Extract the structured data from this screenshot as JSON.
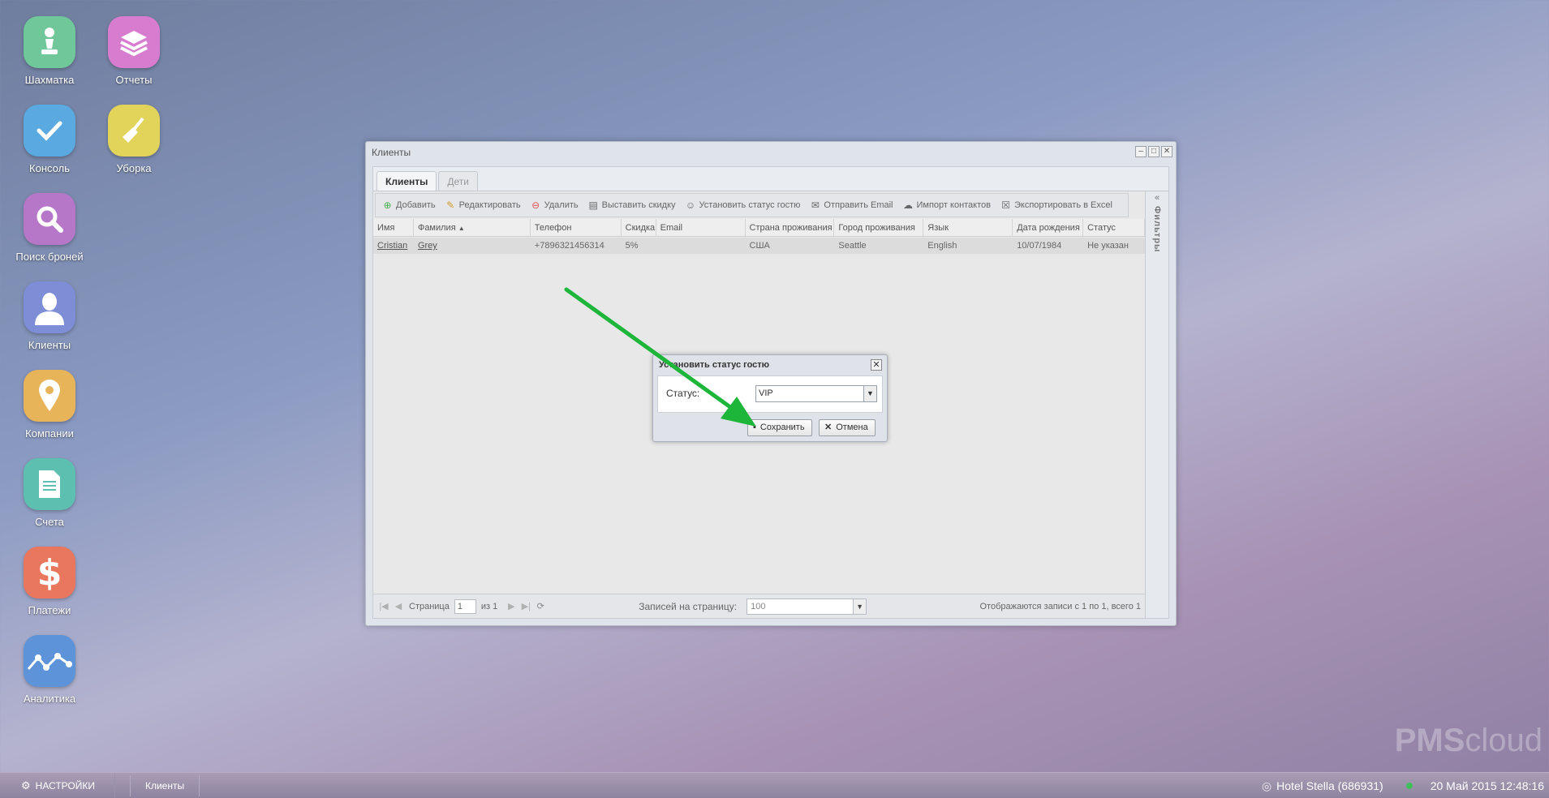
{
  "desktop": {
    "icons": [
      {
        "label": "Шахматка",
        "icon": "chess-pawn-icon",
        "color": "#6fc79a"
      },
      {
        "label": "Отчеты",
        "icon": "books-icon",
        "color": "#d77ccf"
      },
      {
        "label": "Консоль",
        "icon": "checkmark-icon",
        "color": "#5aa9e0"
      },
      {
        "label": "Уборка",
        "icon": "broom-icon",
        "color": "#e2d35a"
      },
      {
        "label": "Поиск броней",
        "icon": "search-icon",
        "color": "#b677c9"
      },
      {
        "label": "Клиенты",
        "icon": "person-icon",
        "color": "#7d8ed6"
      },
      {
        "label": "Компании",
        "icon": "map-pin-icon",
        "color": "#e8b45a"
      },
      {
        "label": "Счета",
        "icon": "document-icon",
        "color": "#5cbfb0"
      },
      {
        "label": "Платежи",
        "icon": "dollar-icon",
        "color": "#e8775e"
      },
      {
        "label": "Аналитика",
        "icon": "line-chart-icon",
        "color": "#5d93d8"
      }
    ]
  },
  "window": {
    "title": "Клиенты",
    "tabs": [
      {
        "label": "Клиенты",
        "active": true
      },
      {
        "label": "Дети",
        "active": false
      }
    ],
    "toolbar": {
      "add": "Добавить",
      "edit": "Редактировать",
      "delete": "Удалить",
      "discount": "Выставить скидку",
      "set_status": "Установить статус гостю",
      "send_email": "Отправить Email",
      "import": "Импорт контактов",
      "export": "Экспортировать в Excel"
    },
    "columns": [
      "Имя",
      "Фамилия",
      "Телефон",
      "Скидка",
      "Email",
      "Страна проживания",
      "Город проживания",
      "Язык",
      "Дата рождения",
      "Статус"
    ],
    "rows": [
      [
        "Cristian",
        "Grey",
        "+7896321456314",
        "5%",
        "",
        "США",
        "Seattle",
        "English",
        "10/07/1984",
        "Не указан"
      ]
    ],
    "filters_label": "Фильтры",
    "pager": {
      "page_label": "Страница",
      "page_value": "1",
      "of_label": "из 1",
      "per_page_label": "Записей на страницу:",
      "per_page_value": "100",
      "summary": "Отображаются записи с 1 по 1, всего 1"
    }
  },
  "dialog": {
    "title": "Установить статус гостю",
    "status_label": "Статус:",
    "status_value": "VIP",
    "save": "Сохранить",
    "cancel": "Отмена"
  },
  "taskbar": {
    "settings": "НАСТРОЙКИ",
    "task": "Клиенты",
    "hotel": "Hotel Stella (686931)",
    "datetime": "20 Май 2015 12:48:16"
  },
  "logo": {
    "brand_a": "PMS",
    "brand_b": "cloud"
  },
  "colors": {
    "arrow": "#1db53a",
    "online": "#3fbf5a"
  }
}
